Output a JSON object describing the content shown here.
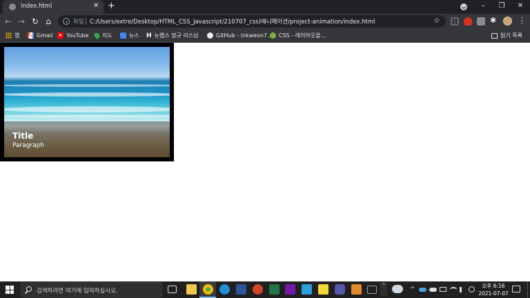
{
  "browser": {
    "tab": {
      "title": "index.html",
      "close_glyph": "✕"
    },
    "new_tab_glyph": "+",
    "window_controls": {
      "minimize": "–",
      "restore": "❐",
      "close": "✕"
    },
    "toolbar": {
      "back": "←",
      "forward": "→",
      "reload": "↻",
      "home": "⌂",
      "scheme_label": "파일",
      "url": "C:/Users/extre/Desktop/HTML_CSS_Javascript/210707_css)애니메이션/project-animation/index.html",
      "star": "☆",
      "extensions_glyph": "✱",
      "menu": "⋮"
    },
    "bookmarks": [
      {
        "label": "앱",
        "icon": "apps-icon"
      },
      {
        "label": "Gmail",
        "icon": "gmail-icon"
      },
      {
        "label": "YouTube",
        "icon": "youtube-icon"
      },
      {
        "label": "지도",
        "icon": "maps-icon"
      },
      {
        "label": "뉴스",
        "icon": "news-icon"
      },
      {
        "label": "뉴랩스 정규 리스닝",
        "icon": "h-icon",
        "icon_text": "H"
      },
      {
        "label": "GitHub - inkweon7...",
        "icon": "github-icon"
      },
      {
        "label": "CSS - 레이아웃을...",
        "icon": "css-icon"
      }
    ],
    "reading_list": "읽기 목록"
  },
  "page": {
    "card": {
      "title": "Title",
      "paragraph": "Paragraph",
      "image": "beach-waves-image"
    }
  },
  "taskbar": {
    "search_placeholder": "검색하려면 여기에 입력하십시오.",
    "tray_up": "^",
    "clock": {
      "time": "오후 6:16",
      "date": "2021-07-07"
    },
    "colors": {
      "explorer": "#f2c94c",
      "chrome": "#4caf50",
      "edge": "#1e90d6",
      "word": "#2b579a",
      "powerpoint": "#d24726",
      "excel": "#217346",
      "onenote": "#7719aa",
      "app_blue": "#29a0da",
      "sticky": "#f7d736",
      "teams": "#5558af",
      "sublime": "#e08a2b",
      "window": "#9aa0a6"
    }
  }
}
